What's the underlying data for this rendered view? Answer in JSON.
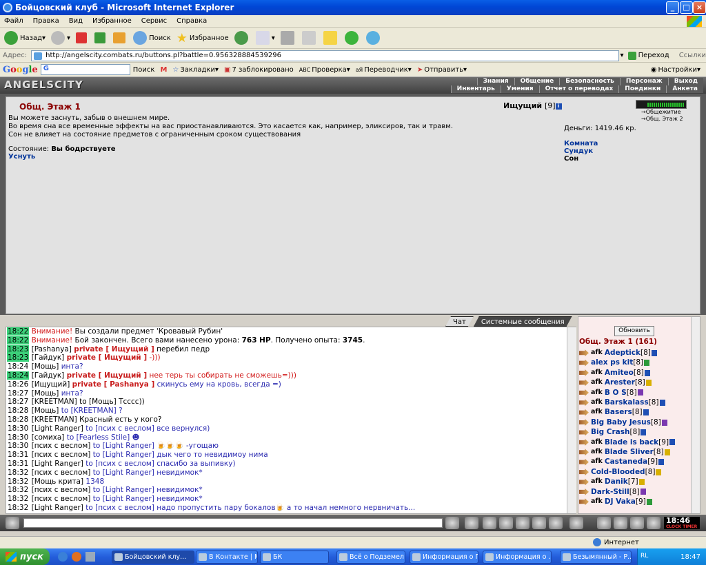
{
  "window": {
    "title": "Бойцовский клуб - Microsoft Internet Explorer"
  },
  "menu": [
    "Файл",
    "Правка",
    "Вид",
    "Избранное",
    "Сервис",
    "Справка"
  ],
  "toolbar": {
    "back": "Назад",
    "search": "Поиск",
    "favorites": "Избранное"
  },
  "address": {
    "label": "Адрес:",
    "url": "http://angelscity.combats.ru/buttons.pl?battle=0.956328884539296",
    "go": "Переход",
    "links": "Ссылки"
  },
  "google": {
    "logo": "Google",
    "search": "Поиск",
    "bookmarks": "Закладки",
    "blocked": "7 заблокировано",
    "check": "Проверка",
    "translator": "Переводчик",
    "send": "Отправить",
    "settings": "Настройки"
  },
  "game": {
    "logo": "ANGELSCITY",
    "nav_top": [
      "Знания",
      "Общение",
      "Безопасность",
      "Персонаж",
      "Выход"
    ],
    "nav_bottom": [
      "Инвентарь",
      "Умения",
      "Отчет о переводах",
      "Поединки",
      "Анкета"
    ]
  },
  "room": {
    "title": "Общ. Этаж 1",
    "desc": [
      "Вы можете заснуть, забыв о внешнем мире.",
      "Во время сна все временные эффекты на вас приостанавливаются. Это касается как, например, эликсиров, так и травм.",
      "Сон не влияет на состояние предметов с ограниченным сроком существования"
    ],
    "state_label": "Состояние:",
    "state_value": "Вы бодрствуете",
    "sleep_link": "Уснуть",
    "player": "Ищущий",
    "player_level": "[9]",
    "money": "Деньги: 1419.46 кр.",
    "links": [
      "Комната",
      "Сундук"
    ],
    "link_selected": "Сон",
    "map_locs": [
      "Общежитие",
      "Общ. Этаж 2"
    ]
  },
  "chat": {
    "tabs": [
      "Чат",
      "Системные сообщения"
    ],
    "lines": [
      {
        "time": "18:22",
        "hl": true,
        "segs": [
          {
            "c": "red",
            "t": "Внимание!"
          },
          {
            "c": "",
            "t": " Вы создали предмет 'Кровавый Рубин'"
          }
        ]
      },
      {
        "time": "18:22",
        "hl": true,
        "segs": [
          {
            "c": "red",
            "t": "Внимание!"
          },
          {
            "c": "",
            "t": " Бой закончен. Всего вами нанесено урона: "
          },
          {
            "c": "b",
            "t": "763 HP"
          },
          {
            "c": "",
            "t": ". Получено опыта: "
          },
          {
            "c": "b",
            "t": "3745"
          },
          {
            "c": "",
            "t": "."
          }
        ]
      },
      {
        "time": "18:23",
        "hl": true,
        "segs": [
          {
            "c": "",
            "t": "[Pashanya] "
          },
          {
            "c": "priv",
            "t": "private [ Ищущий ]"
          },
          {
            "c": "",
            "t": " перебил педр"
          }
        ]
      },
      {
        "time": "18:23",
        "hl": true,
        "segs": [
          {
            "c": "",
            "t": "[Гайдук] "
          },
          {
            "c": "priv",
            "t": "private [ Ищущий ]"
          },
          {
            "c": "red",
            "t": " -)))"
          }
        ]
      },
      {
        "time": "18:24",
        "hl": false,
        "segs": [
          {
            "c": "",
            "t": "[Мощь] "
          },
          {
            "c": "blue",
            "t": "инта?"
          }
        ]
      },
      {
        "time": "18:24",
        "hl": true,
        "segs": [
          {
            "c": "",
            "t": "[Гайдук] "
          },
          {
            "c": "priv",
            "t": "private [ Ищущий ]"
          },
          {
            "c": "red",
            "t": " нее терь ты собирать не сможешь=)))"
          }
        ]
      },
      {
        "time": "18:26",
        "hl": false,
        "segs": [
          {
            "c": "",
            "t": "[Ищущий] "
          },
          {
            "c": "priv",
            "t": "private [ Pashanya ]"
          },
          {
            "c": "blue",
            "t": " скинусь ему на кровь, всегда =)"
          }
        ]
      },
      {
        "time": "18:27",
        "hl": false,
        "segs": [
          {
            "c": "",
            "t": "[Мощь] "
          },
          {
            "c": "blue",
            "t": "инта?"
          }
        ]
      },
      {
        "time": "18:27",
        "hl": false,
        "segs": [
          {
            "c": "",
            "t": "[KREETMAN] to [Мощь] Тсссс))"
          }
        ]
      },
      {
        "time": "18:28",
        "hl": false,
        "segs": [
          {
            "c": "",
            "t": "[Мощь] "
          },
          {
            "c": "blue",
            "t": "to [KREETMAN] ?"
          }
        ]
      },
      {
        "time": "18:28",
        "hl": false,
        "segs": [
          {
            "c": "",
            "t": "[KREETMAN] Красный есть у кого?"
          }
        ]
      },
      {
        "time": "18:30",
        "hl": false,
        "segs": [
          {
            "c": "",
            "t": "[Light Ranger] "
          },
          {
            "c": "blue",
            "t": "to [псих с веслом] все вернулся)"
          }
        ]
      },
      {
        "time": "18:30",
        "hl": false,
        "segs": [
          {
            "c": "",
            "t": "[сомиха] "
          },
          {
            "c": "blue",
            "t": "to [Fearless Stile] ☻"
          }
        ]
      },
      {
        "time": "18:30",
        "hl": false,
        "segs": [
          {
            "c": "",
            "t": "[псих с веслом] "
          },
          {
            "c": "blue",
            "t": "to [Light Ranger] 🍺🍺🍺 -угощаю"
          }
        ]
      },
      {
        "time": "18:31",
        "hl": false,
        "segs": [
          {
            "c": "",
            "t": "[псих с веслом] "
          },
          {
            "c": "blue",
            "t": "to [Light Ranger] дык чего то невидимоу нима"
          }
        ]
      },
      {
        "time": "18:31",
        "hl": false,
        "segs": [
          {
            "c": "",
            "t": "[Light Ranger] "
          },
          {
            "c": "blue",
            "t": "to [псих с веслом] спасибо за выпивку)"
          }
        ]
      },
      {
        "time": "18:32",
        "hl": false,
        "segs": [
          {
            "c": "",
            "t": "[псих с веслом] "
          },
          {
            "c": "blue",
            "t": "to [Light Ranger] невидимок*"
          }
        ]
      },
      {
        "time": "18:32",
        "hl": false,
        "segs": [
          {
            "c": "",
            "t": "[Мощь крита] "
          },
          {
            "c": "blue",
            "t": "1348"
          }
        ]
      },
      {
        "time": "18:32",
        "hl": false,
        "segs": [
          {
            "c": "",
            "t": "[псих с веслом] "
          },
          {
            "c": "blue",
            "t": "to [Light Ranger] невидимок*"
          }
        ]
      },
      {
        "time": "18:32",
        "hl": false,
        "segs": [
          {
            "c": "",
            "t": "[псих с веслом] "
          },
          {
            "c": "blue",
            "t": "to [Light Ranger] невидимок*"
          }
        ]
      },
      {
        "time": "18:32",
        "hl": false,
        "segs": [
          {
            "c": "",
            "t": "[Light Ranger] "
          },
          {
            "c": "blue",
            "t": "to [псих с веслом] надо пропустить пару бокалов🍺 а то начал немного нервничать..."
          }
        ]
      }
    ]
  },
  "users": {
    "refresh": "Обновить",
    "room_count": "Общ. Этаж 1 (161)",
    "list": [
      {
        "afk": true,
        "name": "Adeptick",
        "lv": "[8]",
        "c": ""
      },
      {
        "afk": false,
        "name": "alex ps kit",
        "lv": "[8]",
        "c": "g"
      },
      {
        "afk": true,
        "name": "Amiteo",
        "lv": "[8]",
        "c": ""
      },
      {
        "afk": true,
        "name": "Arester",
        "lv": "[8]",
        "c": "y"
      },
      {
        "afk": true,
        "name": "B O S",
        "lv": "[8]",
        "c": "p"
      },
      {
        "afk": true,
        "name": "Barskalass",
        "lv": "[8]",
        "c": ""
      },
      {
        "afk": true,
        "name": "Basers",
        "lv": "[8]",
        "c": ""
      },
      {
        "afk": false,
        "name": "Big Baby Jesus",
        "lv": "[8]",
        "c": "p"
      },
      {
        "afk": false,
        "name": "Big Crash",
        "lv": "[8]",
        "c": ""
      },
      {
        "afk": true,
        "name": "Blade is back",
        "lv": "[9]",
        "c": ""
      },
      {
        "afk": true,
        "name": "Blade Sliver",
        "lv": "[8]",
        "c": "y"
      },
      {
        "afk": true,
        "name": "Castaneda",
        "lv": "[9]",
        "c": ""
      },
      {
        "afk": false,
        "name": "Cold-Blooded",
        "lv": "[8]",
        "c": "y"
      },
      {
        "afk": true,
        "name": "Danik",
        "lv": "[7]",
        "c": "y"
      },
      {
        "afk": false,
        "name": "Dark-Still",
        "lv": "[8]",
        "c": "p"
      },
      {
        "afk": true,
        "name": "DJ Vaka",
        "lv": "[9]",
        "c": "g"
      }
    ]
  },
  "clock": {
    "time": "18:46",
    "labels": "CLOCK TIMER"
  },
  "status": {
    "zone": "Интернет"
  },
  "taskbar": {
    "start": "пуск",
    "tasks": [
      "Бойцовский клу...",
      "В Контакте | М...",
      "БК",
      "Всё о Подземел...",
      "Информация о Г...",
      "Информация о ...",
      "Безымянный - Р..."
    ],
    "lang": "RL",
    "time": "18:47"
  }
}
